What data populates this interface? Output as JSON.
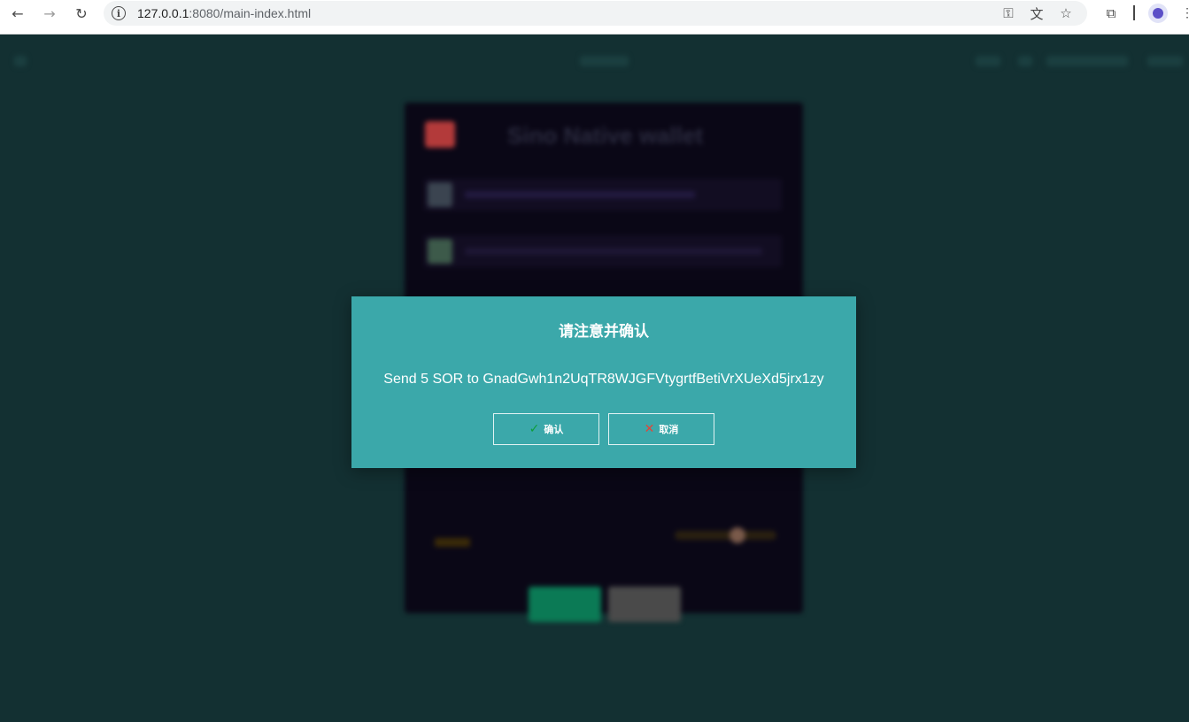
{
  "browser": {
    "url_host": "127.0.0.1",
    "url_path": ":8080/main-index.html",
    "icons": {
      "back": "arrow-left-icon",
      "forward": "arrow-right-icon",
      "reload": "reload-icon",
      "site_info": "info-icon",
      "password": "key-icon",
      "translate": "translate-icon",
      "bookmark": "star-icon",
      "extensions": "puzzle-icon",
      "profile": "person-icon",
      "menu": "kebab-menu-icon"
    }
  },
  "background_app": {
    "wallet_title": "Sino Native wallet"
  },
  "dialog": {
    "title": "请注意并确认",
    "message": "Send 5 SOR to GnadGwh1n2UqTR8WJGFVtygrtfBetiVrXUeXd5jrx1zy",
    "confirm_label": "确认",
    "cancel_label": "取消",
    "confirm_icon": "checkmark-icon",
    "cancel_icon": "close-icon"
  },
  "colors": {
    "page_background": "#133032",
    "dialog_background": "#3ba8aa",
    "confirm_icon_color": "#0d9e3a",
    "cancel_icon_color": "#e0463a"
  }
}
